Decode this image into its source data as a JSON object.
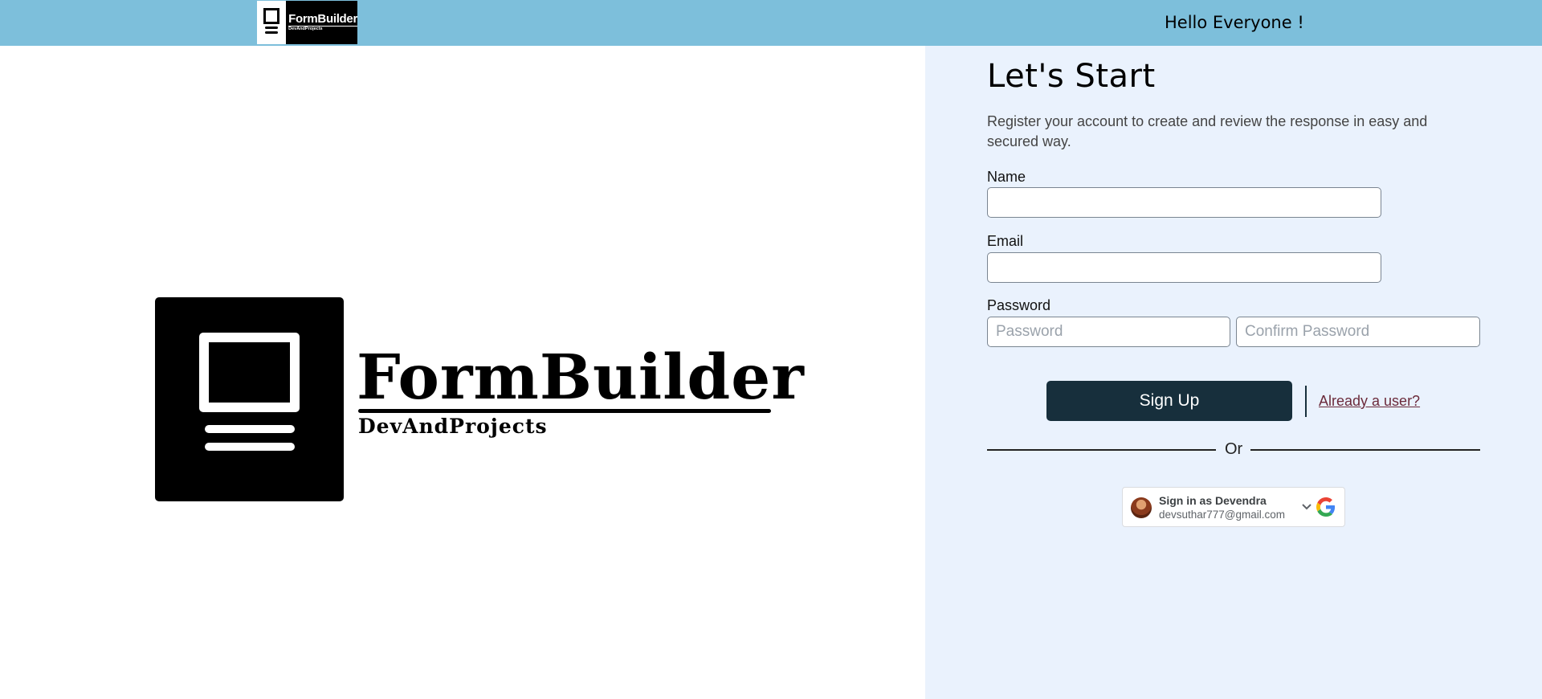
{
  "header": {
    "logo": {
      "title": "FormBuilder",
      "subtitle": "DevAndProjects"
    },
    "greeting": "Hello Everyone !"
  },
  "hero_logo": {
    "title": "FormBuilder",
    "subtitle": "DevAndProjects"
  },
  "form": {
    "title": "Let's Start",
    "description": "Register your account to create and review the response in easy and secured way.",
    "name_label": "Name",
    "name_value": "",
    "email_label": "Email",
    "email_value": "",
    "password_label": "Password",
    "password_placeholder": "Password",
    "confirm_password_placeholder": "Confirm Password",
    "signup_label": "Sign Up",
    "login_link": "Already a user?",
    "or_text": "Or"
  },
  "google_signin": {
    "title": "Sign in as Devendra",
    "email": "devsuthar777@gmail.com",
    "icon": "google-g-icon"
  },
  "colors": {
    "header_bg": "#7dbfdb",
    "panel_bg": "#eaf2fd",
    "primary_button": "#172f3c",
    "link": "#6b2a3a"
  }
}
